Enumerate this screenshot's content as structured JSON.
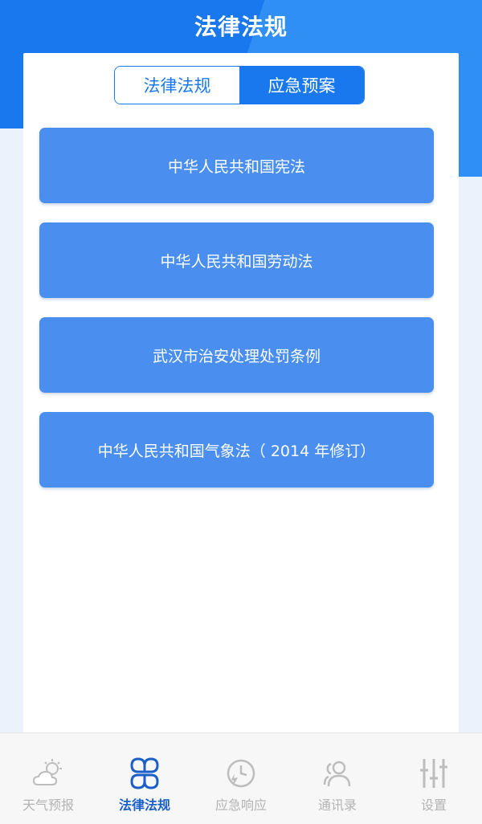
{
  "header": {
    "title": "法律法规"
  },
  "tabs": [
    {
      "label": "法律法规",
      "active": false
    },
    {
      "label": "应急预案",
      "active": true
    }
  ],
  "laws": [
    {
      "title": "中华人民共和国宪法"
    },
    {
      "title": "中华人民共和国劳动法"
    },
    {
      "title": "武汉市治安处理处罚条例"
    },
    {
      "title": "中华人民共和国气象法（ 2014 年修订）"
    }
  ],
  "bottom_nav": [
    {
      "label": "天气预报",
      "icon": "weather-icon",
      "active": false
    },
    {
      "label": "法律法规",
      "icon": "laws-icon",
      "active": true
    },
    {
      "label": "应急响应",
      "icon": "emergency-response-icon",
      "active": false
    },
    {
      "label": "通讯录",
      "icon": "contacts-icon",
      "active": false
    },
    {
      "label": "设置",
      "icon": "settings-sliders-icon",
      "active": false
    }
  ],
  "colors": {
    "primary": "#1a78ee",
    "item_bg": "#4a8ff0",
    "nav_active": "#1a5fc7",
    "nav_inactive": "#b3b3b3"
  }
}
